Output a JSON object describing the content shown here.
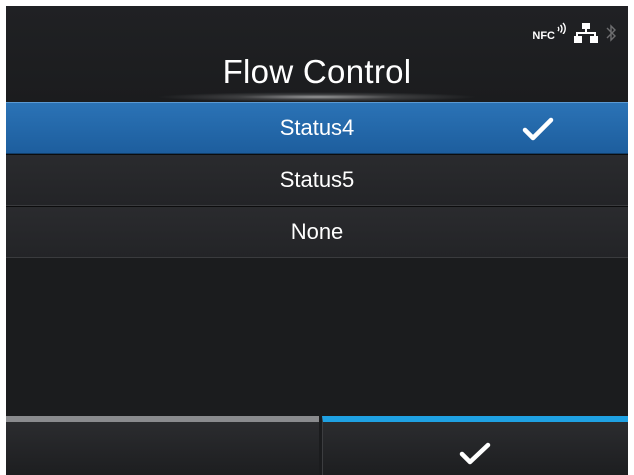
{
  "screen": {
    "title": "Flow Control",
    "status_icons": {
      "nfc_label": "NFC",
      "nfc": "nfc-icon",
      "network": "network-icon",
      "bluetooth": "bluetooth-icon"
    }
  },
  "options": [
    {
      "label": "Status4",
      "selected": true
    },
    {
      "label": "Status5",
      "selected": false
    },
    {
      "label": "None",
      "selected": false
    }
  ],
  "softkeys": {
    "left": {
      "icon": ""
    },
    "right": {
      "icon": "checkmark-icon"
    }
  },
  "colors": {
    "background": "#1b1c1e",
    "selected_row": "#2466a8",
    "softkey_left_bar": "#8a8b8e",
    "softkey_right_bar": "#1fa1e3",
    "text": "#ffffff"
  }
}
